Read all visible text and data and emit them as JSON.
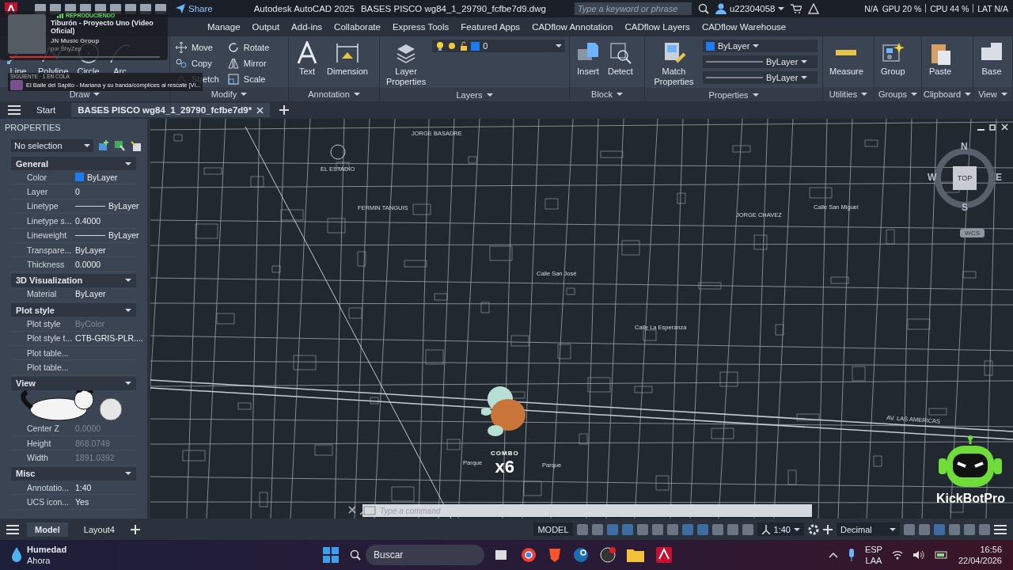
{
  "title_bar": {
    "share": "Share",
    "app_title": "Autodesk AutoCAD 2025",
    "file_title": "BASES PISCO wg84_1_29790_fcfbe7d9.dwg",
    "search": {
      "placeholder": "Type a keyword or phrase"
    },
    "user": "u22304058",
    "stats": [
      "N/A",
      "GPU 20 %",
      "CPU 44 %",
      "LAT N/A"
    ]
  },
  "ribbon_tabs": [
    "Manage",
    "Output",
    "Add-ins",
    "Collaborate",
    "Express Tools",
    "Featured Apps",
    "CADflow Annotation",
    "CADflow Layers",
    "CADflow Warehouse"
  ],
  "ribbon_panels": [
    {
      "title": "Draw",
      "large_tools": [
        {
          "label": "Line",
          "kind": "line"
        },
        {
          "label": "Polyline",
          "kind": "polyline"
        },
        {
          "label": "Circle",
          "kind": "circle"
        },
        {
          "label": "Arc",
          "kind": "arc"
        }
      ]
    },
    {
      "title": "Modify",
      "small_tools": [
        {
          "label": "Move",
          "kind": "move"
        },
        {
          "label": "Copy",
          "kind": "copy"
        },
        {
          "label": "Stretch",
          "kind": "stretch"
        },
        {
          "label": "Rotate",
          "kind": "rotate"
        },
        {
          "label": "Mirror",
          "kind": "mirror"
        },
        {
          "label": "Scale",
          "kind": "scale"
        }
      ]
    },
    {
      "title": "Annotation",
      "large_tools": [
        {
          "label": "Text",
          "kind": "text"
        },
        {
          "label": "Dimension",
          "kind": "dimension"
        }
      ]
    },
    {
      "title": "Layers",
      "large_tools": [
        {
          "label": "Layer Properties",
          "kind": "layers"
        }
      ],
      "dropdowns": [
        {
          "value": "0",
          "kind": "layer"
        }
      ]
    },
    {
      "title": "Block",
      "large_tools": [
        {
          "label": "Insert",
          "kind": "insert"
        },
        {
          "label": "Detect",
          "kind": "detect"
        }
      ]
    },
    {
      "title": "Properties",
      "large_tools": [
        {
          "label": "Match Properties",
          "kind": "match"
        }
      ],
      "dropdowns": [
        {
          "value": "ByLayer",
          "kind": "color"
        },
        {
          "value": "ByLayer",
          "kind": "linetype"
        },
        {
          "value": "ByLayer",
          "kind": "lineweight"
        }
      ]
    },
    {
      "title": "Utilities",
      "large_tools": [
        {
          "label": "Measure",
          "kind": "measure"
        }
      ]
    },
    {
      "title": "Groups",
      "large_tools": [
        {
          "label": "Group",
          "kind": "group"
        }
      ]
    },
    {
      "title": "Clipboard",
      "large_tools": [
        {
          "label": "Paste",
          "kind": "paste"
        }
      ]
    },
    {
      "title": "View",
      "large_tools": [
        {
          "label": "Base",
          "kind": "base"
        }
      ]
    }
  ],
  "file_tabs": [
    {
      "label": "Start",
      "selected": false
    },
    {
      "label": "BASES PISCO wg84_1_29790_fcfbe7d9*",
      "selected": true
    }
  ],
  "properties_panel": {
    "title": "PROPERTIES",
    "selection": "No selection",
    "sections": [
      {
        "title": "General",
        "kind": "plain",
        "rows": [
          {
            "label": "Color",
            "value": "ByLayer",
            "kind": "color",
            "disabled": false
          },
          {
            "label": "Layer",
            "value": "0",
            "kind": "text",
            "disabled": false
          },
          {
            "label": "Linetype",
            "value": "ByLayer",
            "kind": "line",
            "disabled": false
          },
          {
            "label": "Linetype  s...",
            "value": "0.4000",
            "kind": "text",
            "disabled": false
          },
          {
            "label": "Lineweight",
            "value": "ByLayer",
            "kind": "line",
            "disabled": false
          },
          {
            "label": "Transpare...",
            "value": "ByLayer",
            "kind": "text",
            "disabled": false
          },
          {
            "label": "Thickness",
            "value": "0.0000",
            "kind": "text",
            "disabled": false
          }
        ]
      },
      {
        "title": "3D Visualization",
        "kind": "plain",
        "rows": [
          {
            "label": "Material",
            "value": "ByLayer",
            "kind": "text",
            "disabled": false
          }
        ]
      },
      {
        "title": "Plot style",
        "kind": "plain",
        "rows": [
          {
            "label": "Plot style",
            "value": "ByColor",
            "kind": "text",
            "disabled": true
          },
          {
            "label": "Plot style t...",
            "value": "CTB-GRIS-PLR....",
            "kind": "text",
            "disabled": false
          },
          {
            "label": "Plot table..."
          },
          {
            "label": "Plot table..."
          }
        ]
      },
      {
        "title": "View",
        "kind": "covered",
        "rows": [
          {
            "label": "Center Z",
            "value": "0.0000",
            "kind": "text",
            "disabled": true
          },
          {
            "label": "Height",
            "value": "868.0749",
            "kind": "text",
            "disabled": true
          },
          {
            "label": "Width",
            "value": "1891.0392",
            "kind": "text",
            "disabled": true
          }
        ]
      },
      {
        "title": "Misc",
        "kind": "plain",
        "rows": [
          {
            "label": "Annotatio...",
            "value": "1:40",
            "kind": "text",
            "disabled": false
          },
          {
            "label": "UCS icon...",
            "value": "Yes",
            "kind": "text",
            "disabled": false
          }
        ]
      }
    ]
  },
  "viewport": {
    "map_labels": [
      "EL ESTADIO",
      "JORGE BASADRE",
      "FERMIN TANGUIS",
      "Calle San José",
      "Calle San Miguel",
      "JORGE CHAVEZ",
      "Calle La Esperanza",
      "AV. LAS AMERICAS",
      "Parque",
      "Parque"
    ],
    "viewcube": {
      "north": "N",
      "west": "W",
      "east": "E",
      "south": "S",
      "face": "TOP",
      "ucs": "WCS"
    },
    "command_line": {
      "placeholder": "Type a command"
    }
  },
  "layout_tabs": [
    {
      "label": "Model",
      "selected": true
    },
    {
      "label": "Layout4",
      "selected": false
    }
  ],
  "status_bar": {
    "space": "MODEL",
    "scale": "1:40",
    "units": "Decimal"
  },
  "taskbar": {
    "weather": {
      "title": "Humedad",
      "subtitle": "Ahora"
    },
    "search": {
      "placeholder": "Buscar"
    },
    "language": "ESP",
    "layout": "LAA",
    "time": "16:56",
    "date": "22/04/2026"
  },
  "music_widget": {
    "status": "REPRODUCIENDO",
    "title": "Tiburón - Proyecto Uno (Video Oficial)",
    "channel": "JN Music Group",
    "by": "por ShyZep",
    "level": 0.3,
    "queue": "SIGUIENTE · 1 EN COLA",
    "next": "El Baile del Sapito - Mariana y su banda/cómplices al rescate [Vi..."
  },
  "stream_overlay": {
    "combo": "COMBO",
    "multiplier": "x6",
    "bot": "KickBotPro"
  }
}
